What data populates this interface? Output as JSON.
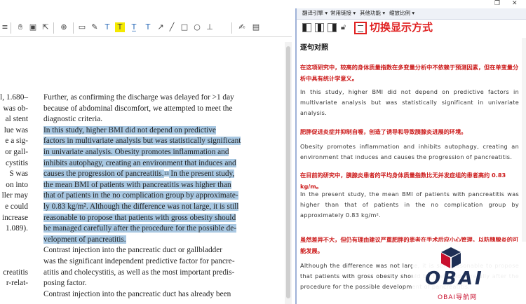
{
  "window": {
    "restore_glyph": "❐",
    "close_glyph": "✕"
  },
  "pdf_toolbar": {
    "icons": [
      "menu-icon",
      "hand-icon",
      "snapshot-icon",
      "select-icon",
      "zoom-icon",
      "comment-icon",
      "note-icon",
      "textbox-icon",
      "highlight-icon",
      "underline-icon",
      "strikeout-icon",
      "arrow-icon",
      "line-icon",
      "rectangle-icon",
      "ellipse-icon",
      "stamp-icon",
      "edit-icon",
      "more-icon"
    ]
  },
  "pdf_page": {
    "left_fragments": [
      "l, 1.680–",
      "was ob-",
      "al stent",
      "lue was",
      "e a sig-",
      "or gall-",
      "cystitis",
      "S was",
      "on into",
      "ller may",
      "e could",
      "increase",
      "1.089).",
      "",
      "",
      "",
      "creatitis",
      "r-relat-"
    ],
    "lines": [
      {
        "text": "Further, as confirming the discharge was delayed for >1 day",
        "hl": false
      },
      {
        "text": "because of abdominal discomfort, we attempted to meet the",
        "hl": false
      },
      {
        "text": "diagnostic criteria.",
        "hl": false
      },
      {
        "text": "    In this study, higher BMI did not depend on predictive",
        "hl": true
      },
      {
        "text": "factors in multivariate analysis but was statistically significant",
        "hl": true
      },
      {
        "text": "in univariate analysis. Obesity promotes inflammation and",
        "hl": true
      },
      {
        "text": "inhibits autophagy, creating an environment that induces and",
        "hl": true
      },
      {
        "text": "causes the progression of pancreatitis.",
        "hl": true,
        "sup": "13",
        "tail": " In the present study,"
      },
      {
        "text": "the mean BMI of patients with pancreatitis was higher than",
        "hl": true
      },
      {
        "text": "that of patients in the no complication group by approximate-",
        "hl": true
      },
      {
        "text": "ly 0.83 kg/m². Although the difference was not large, it is still",
        "hl": true
      },
      {
        "text": "reasonable to propose that patients with gross obesity should",
        "hl": true
      },
      {
        "text": "be managed carefully after the procedure for the possible de-",
        "hl": true
      },
      {
        "text": "velopment of pancreatitis.",
        "hl": true
      },
      {
        "text": "    Contrast injection into the pancreatic duct or gallbladder",
        "hl": false
      },
      {
        "text": "was the significant independent predictive factor for pancre-",
        "hl": false
      },
      {
        "text": "atitis and cholecystitis, as well as the most important predis-",
        "hl": false
      },
      {
        "text": "posing factor.",
        "hl": false
      },
      {
        "text": "    Contrast injection into the pancreatic duct has already been",
        "hl": false
      }
    ]
  },
  "panel": {
    "menu": [
      "翻译引擎 ▾",
      "常用链接 ▾",
      "其他功能 ▾",
      "缩放比例 ▾"
    ],
    "switch_label": "切换显示方式",
    "title": "逐句对照",
    "pairs": [
      {
        "zh": "在这项研究中，较高的身体质量指数在多变量分析中不依赖于预测因素，但在单变量分析中具有统计学意义。",
        "en": "In this study, higher BMI did not depend on predictive factors in multivariate analysis but was statistically significant in univariate analysis."
      },
      {
        "zh": "肥胖促进炎症并抑制自噬，创造了诱导和导致胰腺炎进展的环境。",
        "en": "Obesity promotes inflammation and inhibits autophagy, creating an environment that induces and causes the progression of pancreatitis."
      },
      {
        "zh": "在目前的研究中，胰腺炎患者的平均身体质量指数比无并发症组的患者高约 0.83 kg/m。",
        "en": "In the present study, the mean BMI of patients with pancreatitis was higher than that of patients in the no complication group by approximately 0.83 kg/m²."
      },
      {
        "zh": "虽然差异不大，但仍有理由建议严重肥胖的患者在手术后应小心管理，以防胰腺炎的可能发展。",
        "en": "Although the difference was not large, it is still reasonable to propose that patients with gross obesity should be managed carefully after the procedure for the possible development of pancreatitis."
      }
    ]
  },
  "logo": {
    "text": "OBAI",
    "sub": "OBAI导航网"
  }
}
